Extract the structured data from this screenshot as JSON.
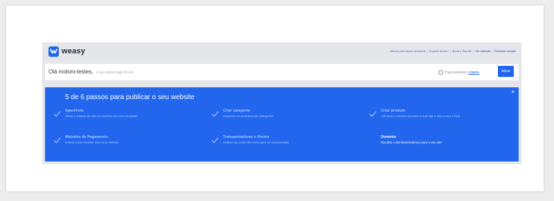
{
  "brand": {
    "name": "weasy"
  },
  "header": {
    "links": [
      {
        "label": "Alterar para layout avançado",
        "bold": false
      },
      {
        "label": "Suporte técnico",
        "bold": false
      },
      {
        "label": "Ajuda e Suporte",
        "bold": false
      },
      {
        "label": "Ver website",
        "bold": true
      },
      {
        "label": "Terminar sessão",
        "bold": true
      }
    ]
  },
  "welcome": {
    "greeting": "Olá moloni-testes,",
    "last_login": "o seu último login foi em",
    "premium_label": "Pack premium",
    "premium_link": "CONTA",
    "activate_button": "Ativar"
  },
  "steps_panel": {
    "title": "5 de 6 passos para publicar o seu website",
    "close_symbol": "×",
    "steps": [
      {
        "title": "Aparência",
        "desc": "Altere o aspeto do site ou escolha um novo template",
        "done": true
      },
      {
        "title": "Criar categoria",
        "desc": "Organize os produtos por categorias",
        "done": true
      },
      {
        "title": "Criar produto",
        "desc": "Adicione o primeiro produto à sua loja e veja como é fácil",
        "done": true
      },
      {
        "title": "Métodos de Pagamento",
        "desc": "Defina como receber dos seus clientes",
        "done": true
      },
      {
        "title": "Transportadoras e Portes",
        "desc": "Atribua um custo de envio para as encomendas",
        "done": true
      },
      {
        "title": "Domínio",
        "desc": "Escolha o domínio/endereço para o seu site",
        "done": false
      }
    ]
  },
  "colors": {
    "accent": "#2166ec",
    "header_bg": "#e4e6ea",
    "done_text": "#a9c6ff",
    "todo_text": "#ffffff"
  },
  "icons": {
    "logo": "weasy-logo-icon",
    "check": "check-icon",
    "close": "close-icon",
    "plus": "plus-circle-icon"
  }
}
